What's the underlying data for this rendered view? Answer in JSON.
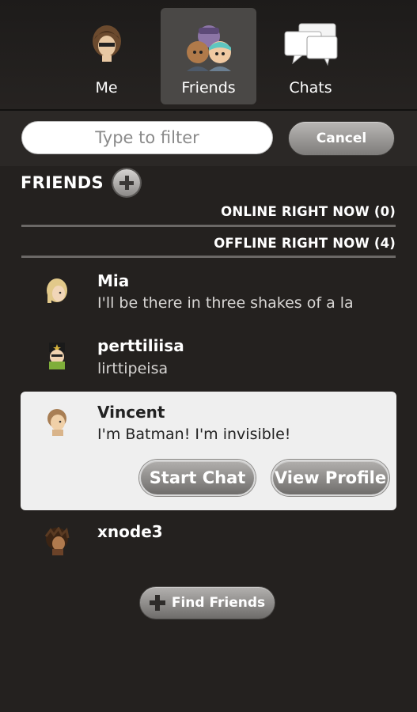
{
  "tabs": [
    {
      "label": "Me",
      "icon": "habbo-avatar-icon"
    },
    {
      "label": "Friends",
      "icon": "friends-group-icon",
      "active": true
    },
    {
      "label": "Chats",
      "icon": "chat-bubbles-icon"
    }
  ],
  "filter": {
    "placeholder": "Type to filter",
    "value": "",
    "cancel_label": "Cancel"
  },
  "friends": {
    "title": "FRIENDS",
    "add_icon": "plus-circle-icon",
    "online_section": "ONLINE RIGHT NOW (0)",
    "offline_section": "OFFLINE RIGHT NOW (4)",
    "list": [
      {
        "name": "Mia",
        "status": " I'll be there in three shakes of a la"
      },
      {
        "name": "perttiliisa",
        "status": "lirttipeisa"
      },
      {
        "name": "Vincent",
        "status": "I'm Batman! I'm invisible!",
        "selected": true
      },
      {
        "name": "xnode3",
        "status": ""
      }
    ],
    "actions": {
      "start_chat": "Start Chat",
      "view_profile": "View Profile"
    },
    "find_friends": "Find Friends"
  },
  "colors": {
    "background": "#24211f",
    "selected_row": "#efefef",
    "button_gray": "#8f8d8b"
  }
}
